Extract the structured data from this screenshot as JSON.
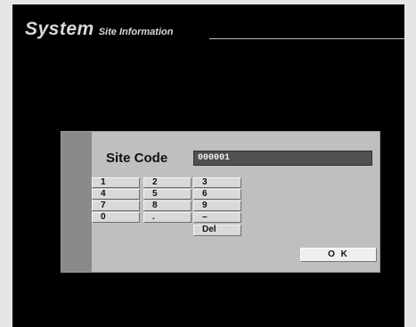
{
  "header": {
    "title": "System",
    "subtitle": "Site Information"
  },
  "dialog": {
    "label": "Site Code",
    "value": "000001",
    "keypad": [
      "1",
      "2",
      "3",
      "4",
      "5",
      "6",
      "7",
      "8",
      "9",
      "0",
      ".",
      "–",
      "Del"
    ],
    "ok_label": "O K"
  }
}
